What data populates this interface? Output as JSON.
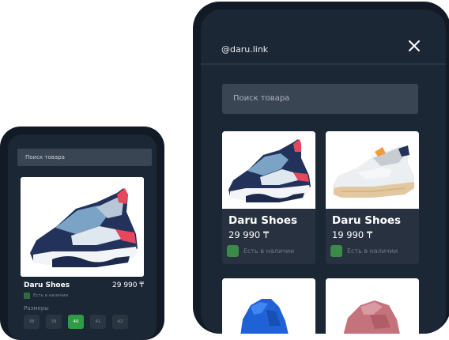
{
  "small_phone": {
    "search_placeholder": "Поиск товара",
    "product": {
      "name": "Daru Shoes",
      "price": "29 990 ₸",
      "availability": "Есть в наличии"
    },
    "sizes_label": "Размеры",
    "sizes": [
      "38",
      "39",
      "40",
      "41",
      "42"
    ],
    "selected_size": "40"
  },
  "big_phone": {
    "handle": "@daru.link",
    "search_placeholder": "Поиск товара",
    "products": [
      {
        "name": "Daru Shoes",
        "price": "29 990 ₸",
        "availability": "Есть в наличии"
      },
      {
        "name": "Daru Shoes",
        "price": "19 990 ₸",
        "availability": "Есть в наличии"
      }
    ]
  },
  "colors": {
    "phone_frame": "#121a26",
    "screen_bg": "#1c2735",
    "card_bg": "#27313f",
    "in_stock_green": "#3c8a47",
    "selected_size_green": "#2f9b45"
  }
}
